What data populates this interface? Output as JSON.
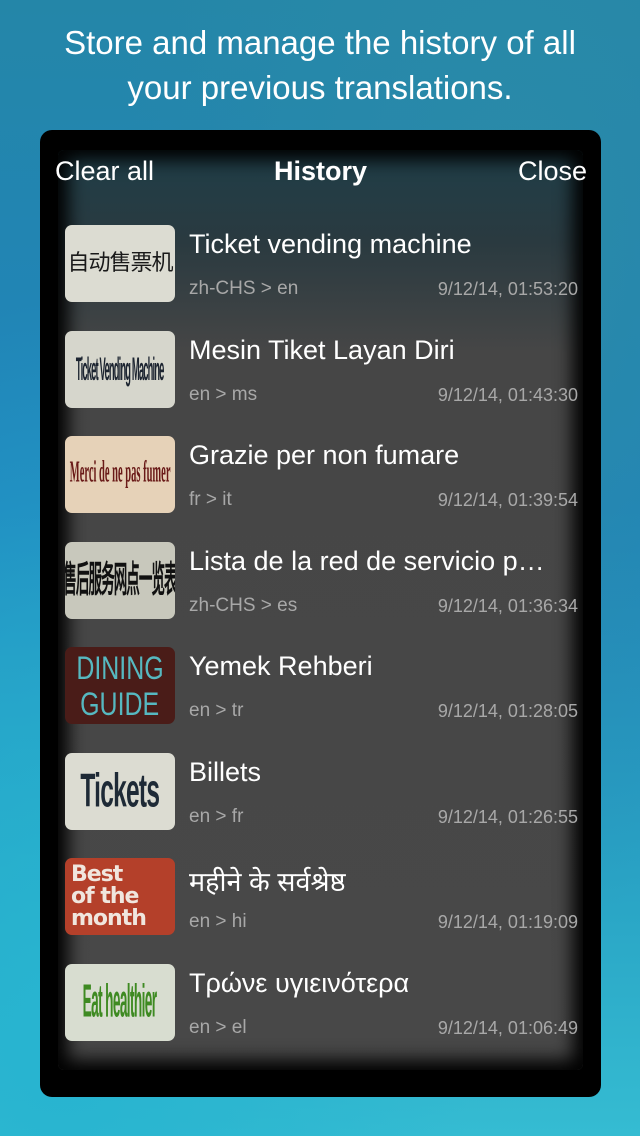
{
  "headline": {
    "line1": "Store and manage the history of all",
    "line2": "your previous translations."
  },
  "nav": {
    "clear_all_label": "Clear all",
    "title": "History",
    "close_label": "Close"
  },
  "history": [
    {
      "thumb_text": [
        "自动售票机"
      ],
      "title": "Ticket vending machine",
      "langs": "zh-CHS > en",
      "timestamp": "9/12/14, 01:53:20"
    },
    {
      "thumb_text": [
        "Ticket Vending Machine"
      ],
      "title": "Mesin Tiket Layan Diri",
      "langs": "en > ms",
      "timestamp": "9/12/14, 01:43:30"
    },
    {
      "thumb_text": [
        "Merci de ne pas fumer"
      ],
      "title": "Grazie per non fumare",
      "langs": "fr > it",
      "timestamp": "9/12/14, 01:39:54"
    },
    {
      "thumb_text": [
        "售后服务网点一览表"
      ],
      "title": "Lista de la red de servicio p…",
      "langs": "zh-CHS > es",
      "timestamp": "9/12/14, 01:36:34"
    },
    {
      "thumb_text": [
        "DINING",
        "GUIDE"
      ],
      "title": "Yemek Rehberi",
      "langs": "en > tr",
      "timestamp": "9/12/14, 01:28:05"
    },
    {
      "thumb_text": [
        "Tickets"
      ],
      "title": "Billets",
      "langs": "en > fr",
      "timestamp": "9/12/14, 01:26:55"
    },
    {
      "thumb_text": [
        "Best",
        "of the",
        "month"
      ],
      "title": "महीने के सर्वश्रेष्ठ",
      "langs": "en > hi",
      "timestamp": "9/12/14, 01:19:09"
    },
    {
      "thumb_text": [
        "Eat healthier"
      ],
      "title": "Τρώνε υγιεινότερα",
      "langs": "en > el",
      "timestamp": "9/12/14, 01:06:49"
    }
  ]
}
